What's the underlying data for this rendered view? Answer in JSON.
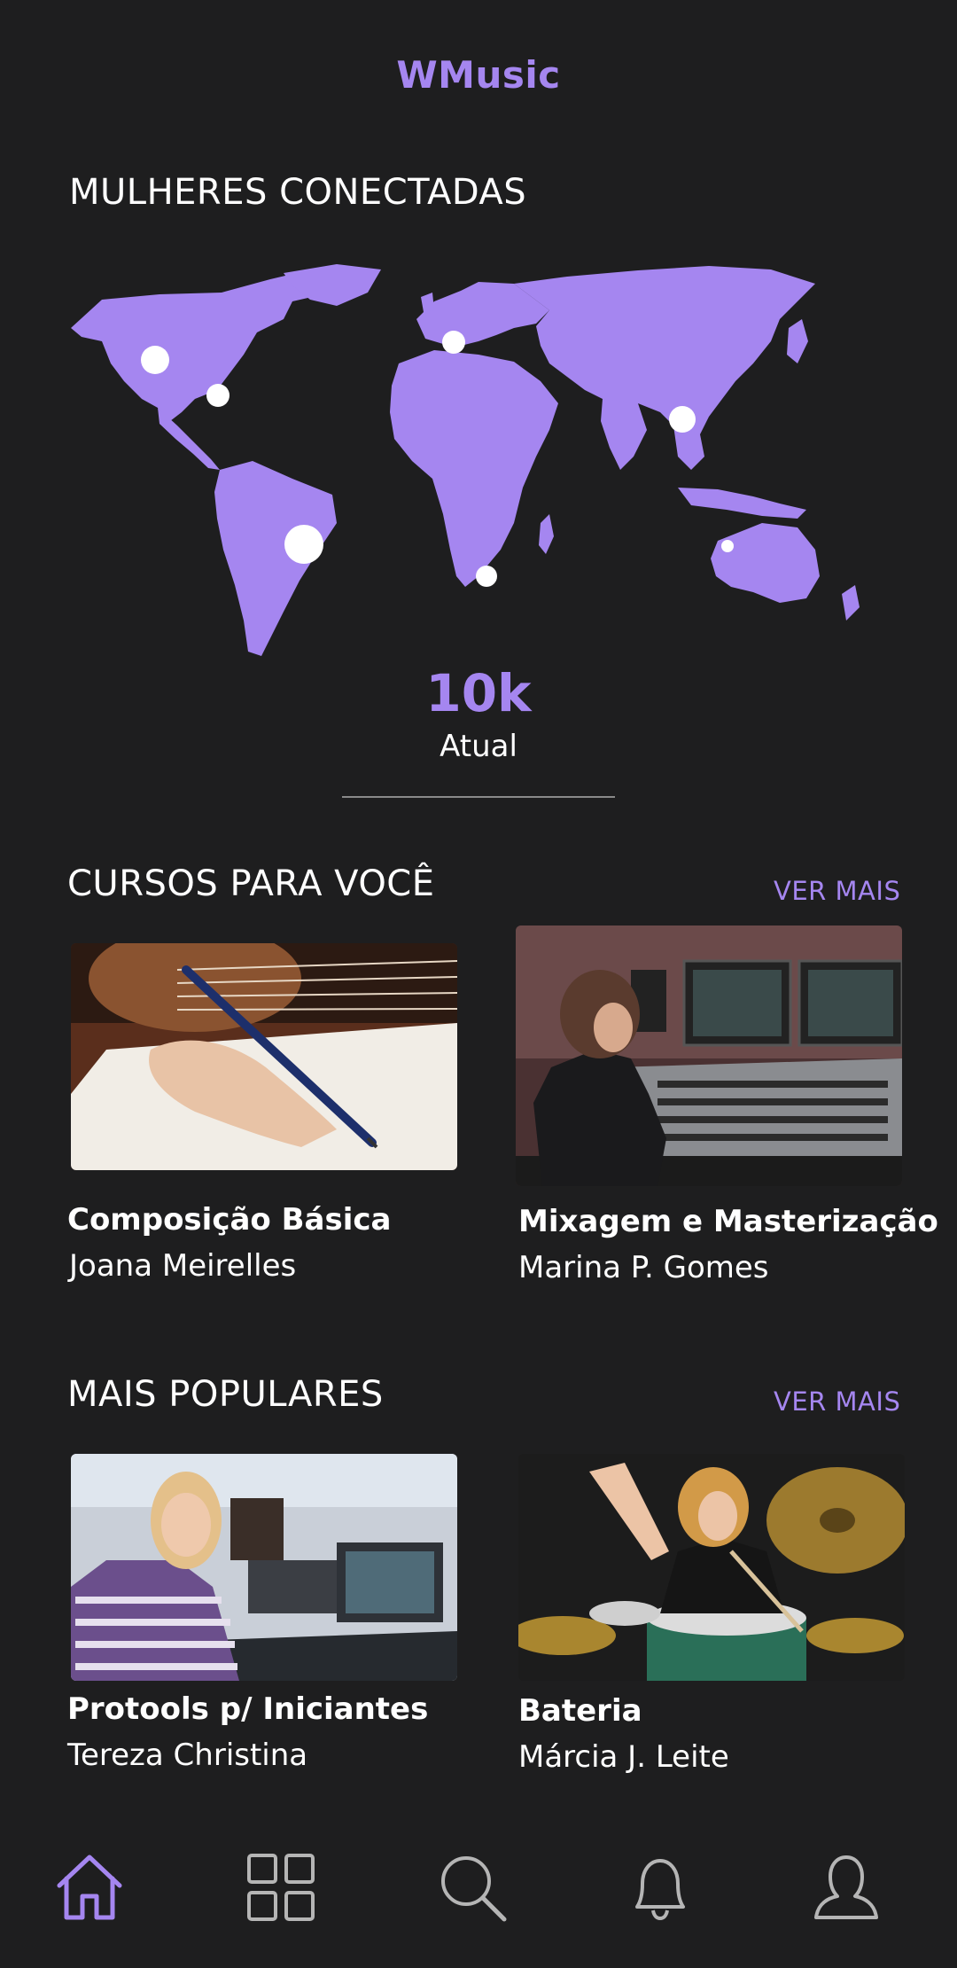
{
  "app": {
    "title": "WMusic"
  },
  "connected": {
    "section_title": "MULHERES CONECTADAS",
    "stat_value": "10k",
    "stat_label": "Atual"
  },
  "courses_for_you": {
    "section_title": "CURSOS PARA VOCÊ",
    "see_more": "VER MAIS",
    "items": [
      {
        "title": "Composição Básica",
        "author": "Joana Meirelles"
      },
      {
        "title": "Mixagem e Masterização",
        "author": "Marina P. Gomes"
      }
    ]
  },
  "most_popular": {
    "section_title": "MAIS POPULARES",
    "see_more": "VER MAIS",
    "items": [
      {
        "title": "Protools p/ Iniciantes",
        "author": "Tereza Christina"
      },
      {
        "title": "Bateria",
        "author": "Márcia J. Leite"
      }
    ]
  },
  "bottom_nav": {
    "items": [
      {
        "icon": "home-icon",
        "active": true
      },
      {
        "icon": "grid-icon",
        "active": false
      },
      {
        "icon": "search-icon",
        "active": false
      },
      {
        "icon": "bell-icon",
        "active": false
      },
      {
        "icon": "profile-icon",
        "active": false
      }
    ]
  },
  "colors": {
    "background": "#1e1e1f",
    "accent": "#a586f0",
    "text": "#ffffff",
    "nav_inactive": "#b5b5b5"
  }
}
